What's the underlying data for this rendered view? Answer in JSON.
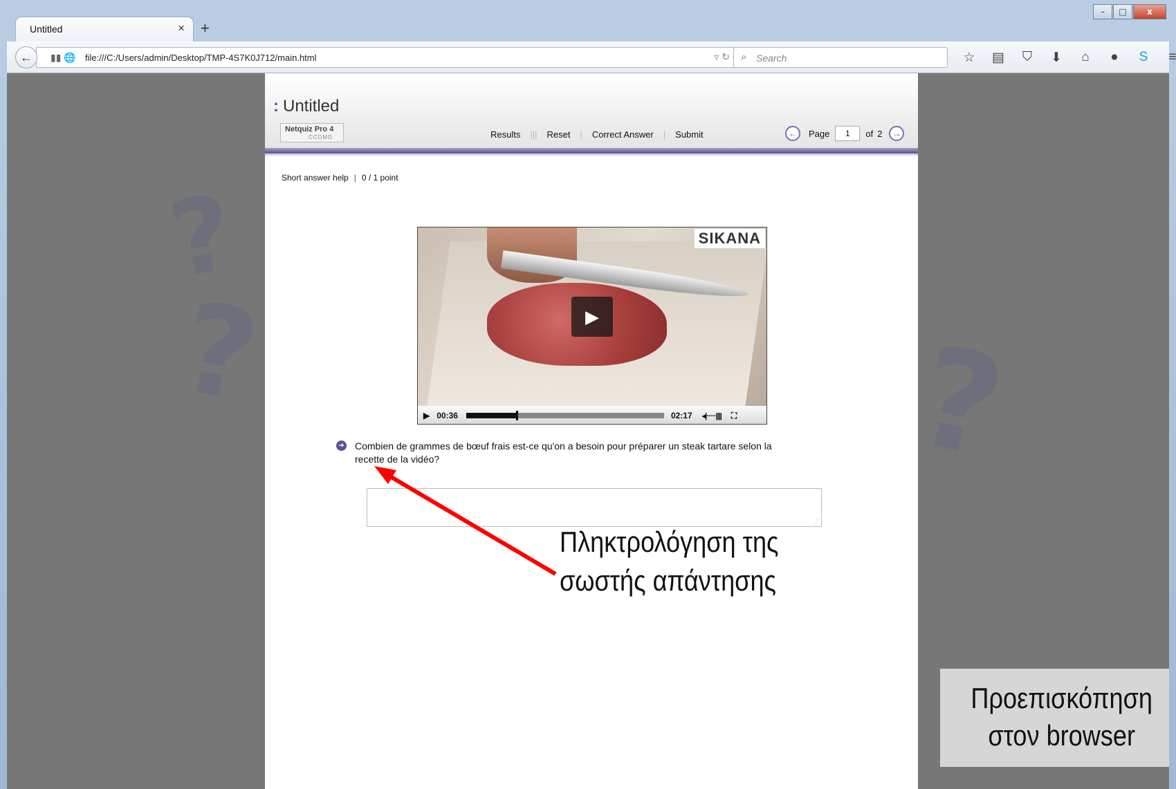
{
  "browser": {
    "tab_title": "Untitled",
    "tab_close": "×",
    "new_tab": "+",
    "url": "file:///C:/Users/admin/Desktop/TMP-4S7K0J712/main.html",
    "search_placeholder": "Search",
    "window_buttons": {
      "minimize": "–",
      "maximize": "□",
      "close": "x"
    },
    "toolbar_icons": [
      "star-icon",
      "reading-list-icon",
      "pocket-icon",
      "download-icon",
      "home-icon",
      "chat-icon",
      "skype-icon",
      "menu-icon"
    ]
  },
  "quiz": {
    "title": "Untitled",
    "logo_name": "Netquiz Pro 4",
    "logo_sub": "CCDMD",
    "menu": {
      "results": "Results",
      "reset": "Reset",
      "correct_answer": "Correct Answer",
      "submit": "Submit"
    },
    "pager": {
      "label": "Page",
      "current": "1",
      "of_label": "of",
      "total": "2"
    },
    "help_link": "Short answer help",
    "points": "0 / 1 point",
    "video": {
      "brand": "SIKANA",
      "current_time": "00:36",
      "duration": "02:17",
      "progress": 0.26
    },
    "question": "Combien de grammes de bœuf frais est-ce qu'on a besoin pour préparer un steak tartare selon la recette de la vidéo?",
    "answer_value": ""
  },
  "annotation": {
    "line1": "Πληκτρολόγηση της",
    "line2": "σωστής απάντησης",
    "arrow_color": "#ff0000"
  },
  "badge": {
    "line1": "Προεπισκόπηση",
    "line2": "στον browser"
  },
  "colors": {
    "accent": "#5d4f98",
    "backdrop": "#777777"
  }
}
